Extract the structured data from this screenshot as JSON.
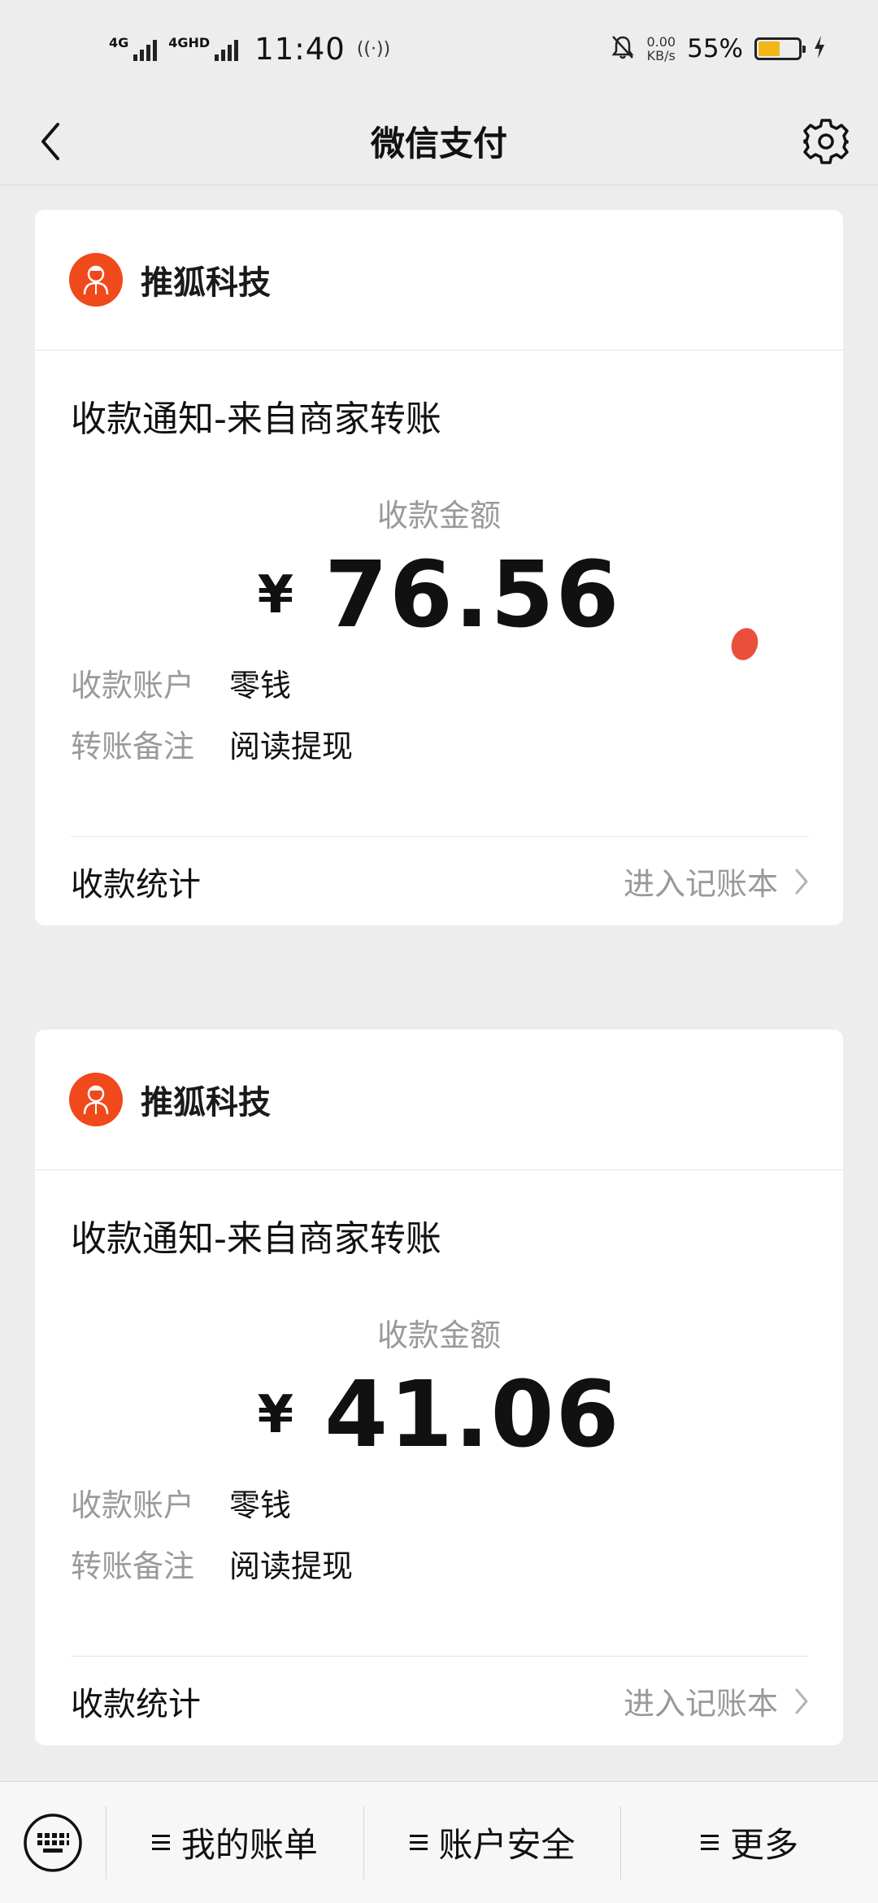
{
  "status_bar": {
    "network1": "4G",
    "network2": "4GHD",
    "time": "11:40",
    "hotspot": "((·))",
    "speed_value": "0.00",
    "speed_unit": "KB/s",
    "battery_percent": "55%",
    "battery_level": 0.55
  },
  "nav": {
    "title": "微信支付"
  },
  "cards": [
    {
      "merchant_name": "推狐科技",
      "notice_title": "收款通知-来自商家转账",
      "amount_label": "收款金额",
      "currency_symbol": "¥",
      "amount": "76.56",
      "account_label": "收款账户",
      "account_value": "零钱",
      "note_label": "转账备注",
      "note_value": "阅读提现",
      "stats_label": "收款统计",
      "ledger_link": "进入记账本"
    },
    {
      "merchant_name": "推狐科技",
      "notice_title": "收款通知-来自商家转账",
      "amount_label": "收款金额",
      "currency_symbol": "¥",
      "amount": "41.06",
      "account_label": "收款账户",
      "account_value": "零钱",
      "note_label": "转账备注",
      "note_value": "阅读提现",
      "stats_label": "收款统计",
      "ledger_link": "进入记账本"
    }
  ],
  "bottom_bar": {
    "tab1": "我的账单",
    "tab2": "账户安全",
    "tab3": "更多"
  },
  "colors": {
    "merchant_logo": "#f0491c",
    "battery": "#f2b718",
    "background": "#ededed"
  }
}
